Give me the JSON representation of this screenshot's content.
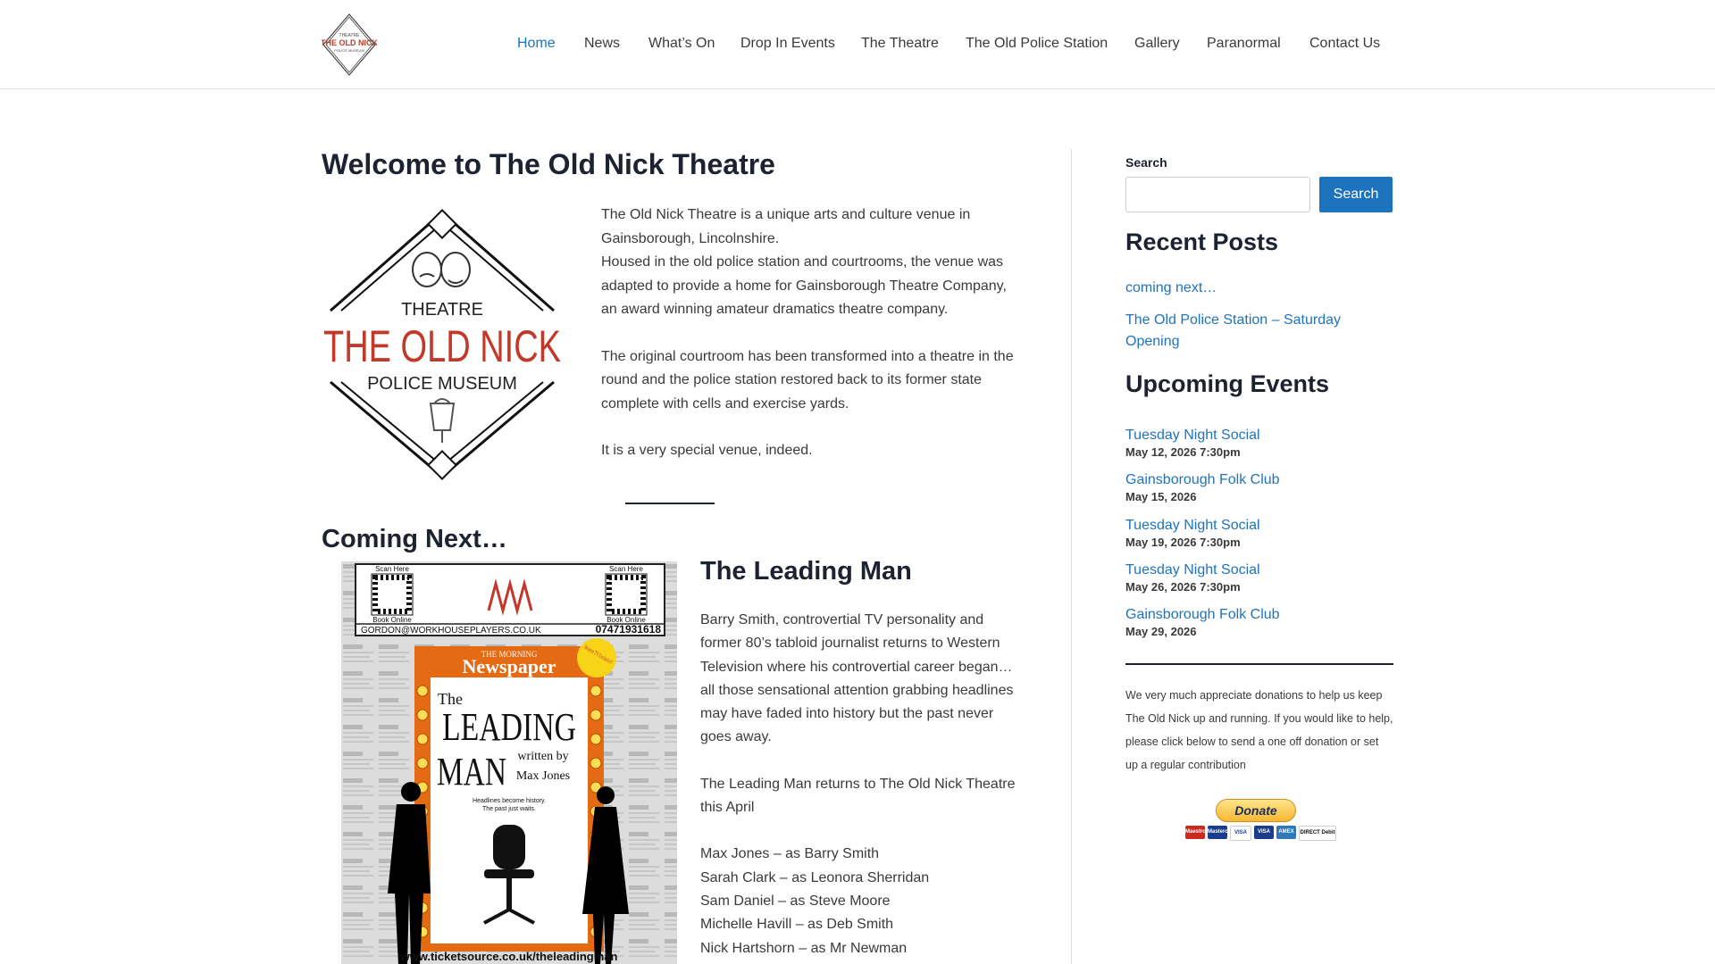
{
  "header": {
    "logo_alt": "Theatre The Old Nick Police Museum",
    "nav": [
      {
        "label": "Home",
        "active": true
      },
      {
        "label": "News",
        "active": false
      },
      {
        "label": "What’s On",
        "active": false
      },
      {
        "label": "Drop In Events",
        "active": false
      },
      {
        "label": "The Theatre",
        "active": false
      },
      {
        "label": "The Old Police Station",
        "active": false
      },
      {
        "label": "Gallery",
        "active": false
      },
      {
        "label": "Paranormal",
        "active": false
      },
      {
        "label": "Contact Us",
        "active": false
      }
    ]
  },
  "main": {
    "title": "Welcome to The Old Nick Theatre",
    "logo": {
      "top": "THEATRE",
      "middle": "THE OLD NICK",
      "bottom": "POLICE MUSEUM"
    },
    "intro": [
      "The Old Nick Theatre is a unique arts and culture venue in Gainsborough, Lincolnshire.",
      "Housed in the old police station and courtrooms, the venue was adapted to provide a home for Gainsborough Theatre Company, an award winning amateur dramatics theatre company.",
      "The original courtroom has been transformed into a theatre in the round and the police station restored back to its former state complete with cells and exercise yards.",
      "It is a very special venue, indeed."
    ],
    "section_title": "Coming Next…",
    "poster": {
      "scan_left": "Scan Here",
      "scan_right": "Scan Here",
      "book_left": "Book Online",
      "book_right": "Book Online",
      "email": "GORDON@WORKHOUSEPLAYERS.CO.UK",
      "phone": "07471931618",
      "masthead": "THE MORNING",
      "newspaper": "Newspaper",
      "badge": "Western TV Exclusive!!",
      "the": "The",
      "leading": "LEADING",
      "man": "MAN",
      "written_by": "written by",
      "author": "Max Jones",
      "tagline1": "Headlines become history.",
      "tagline2": "The past just waits.",
      "url": "www.ticketsource.co.uk/theleadingman"
    },
    "show_title": "The Leading Man",
    "show_paragraphs": [
      "Barry Smith, controvertial TV personality and former 80’s tabloid journalist returns to Western Television where his controvertial career began… all those sensational attention grabbing headlines may have faded into history but the past never goes away.",
      "The Leading Man returns to The Old Nick Theatre this April"
    ],
    "cast": [
      "Max Jones – as Barry Smith",
      "Sarah Clark – as Leonora Sherridan",
      "Sam Daniel – as Steve Moore",
      "Michelle Havill – as Deb Smith",
      "Nick Hartshorn – as Mr Newman"
    ]
  },
  "sidebar": {
    "search_label": "Search",
    "search_placeholder": "",
    "search_button": "Search",
    "recent_title": "Recent Posts",
    "recent_posts": [
      "coming next…",
      "The Old Police Station – Saturday Opening"
    ],
    "events_title": "Upcoming Events",
    "events": [
      {
        "name": "Tuesday Night Social",
        "date": "May 12, 2026 7:30pm"
      },
      {
        "name": "Gainsborough Folk Club",
        "date": "May 15, 2026"
      },
      {
        "name": "Tuesday Night Social",
        "date": "May 19, 2026 7:30pm"
      },
      {
        "name": "Tuesday Night Social",
        "date": "May 26, 2026 7:30pm"
      },
      {
        "name": "Gainsborough Folk Club",
        "date": "May 29, 2026"
      }
    ],
    "donate_text": "We very much appreciate donations to help us keep The Old Nick up and running. If you would like to help, please click below to send a one off donation or set up a regular contribution",
    "donate_button": "Donate",
    "cards": [
      "Maestro",
      "Mastercard",
      "VISA",
      "VISA",
      "AMEX",
      "DIRECT Debit"
    ]
  },
  "colors": {
    "accent": "#1e73be",
    "heading": "#1d2231",
    "text": "#3a3a3a",
    "logo_red": "#c0392b"
  }
}
